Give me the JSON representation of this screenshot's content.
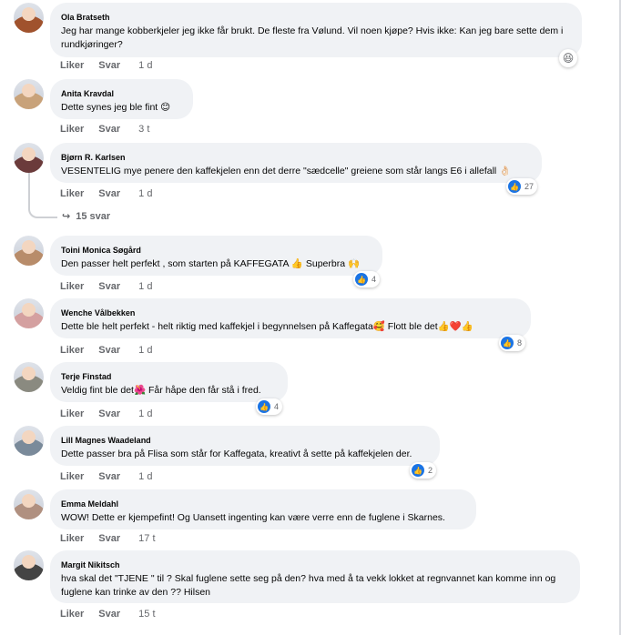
{
  "comments": [
    {
      "author": "Ola Bratseth",
      "text": "Jeg har mange kobberkjeler jeg ikke får brukt. De fleste fra Vølund. Vil noen kjøpe? Hvis ikke: Kan jeg bare sette dem i rundkjøringer?",
      "like": "Liker",
      "reply": "Svar",
      "time": "1 d",
      "reaction_emoji": "😆",
      "reaction_count": "",
      "avatar_color": "#a0522d"
    },
    {
      "author": "Anita Kravdal",
      "text": "Dette synes jeg ble fint 😊",
      "like": "Liker",
      "reply": "Svar",
      "time": "3 t",
      "reaction_emoji": "",
      "reaction_count": "",
      "avatar_color": "#c8a27a"
    },
    {
      "author": "Bjørn R. Karlsen",
      "text": "VESENTELIG mye penere den kaffekjelen enn det derre \"sædcelle\" greiene som står langs E6 i allefall 👌🏻",
      "like": "Liker",
      "reply": "Svar",
      "time": "1 d",
      "reaction_emoji": "👍",
      "reaction_count": "27",
      "avatar_color": "#6b3b3b"
    },
    {
      "author": "Toini Monica Søgård",
      "text": "Den passer helt perfekt , som starten på KAFFEGATA 👍 Superbra 🙌",
      "like": "Liker",
      "reply": "Svar",
      "time": "1 d",
      "reaction_emoji": "👍",
      "reaction_count": "4",
      "avatar_color": "#b88c6a"
    },
    {
      "author": "Wenche Vålbekken",
      "text": "Dette ble helt perfekt - helt riktig med kaffekjel i begynnelsen på Kaffegata🥰 Flott ble det👍❤️👍",
      "like": "Liker",
      "reply": "Svar",
      "time": "1 d",
      "reaction_emoji": "👍",
      "reaction_count": "8",
      "avatar_color": "#d4a0a0"
    },
    {
      "author": "Terje Finstad",
      "text": "Veldig fint ble det🌺 Får håpe den får stå i fred.",
      "like": "Liker",
      "reply": "Svar",
      "time": "1 d",
      "reaction_emoji": "👍",
      "reaction_count": "4",
      "avatar_color": "#8a8a80"
    },
    {
      "author": "Lill Magnes Waadeland",
      "text": "Dette passer bra på Flisa som står for Kaffegata, kreativt å sette på kaffekjelen der.",
      "like": "Liker",
      "reply": "Svar",
      "time": "1 d",
      "reaction_emoji": "👍",
      "reaction_count": "2",
      "avatar_color": "#7a8a9a"
    },
    {
      "author": "Emma Meldahl",
      "text": "WOW! Dette er kjempefint! Og Uansett ingenting kan være verre enn de fuglene i Skarnes.",
      "like": "Liker",
      "reply": "Svar",
      "time": "17 t",
      "reaction_emoji": "",
      "reaction_count": "",
      "avatar_color": "#b09080"
    },
    {
      "author": "Margit Nikitsch",
      "text": "hva skal det \"TJENE \" til ? Skal fuglene sette seg på den? hva med å ta vekk lokket at regnvannet kan komme inn og fuglene kan trinke av den ?? Hilsen",
      "like": "Liker",
      "reply": "Svar",
      "time": "15 t",
      "reaction_emoji": "",
      "reaction_count": "",
      "avatar_color": "#444444"
    }
  ],
  "thread": {
    "replies_label": "15 svar",
    "reply_arrow": "↪"
  },
  "colors": {
    "bubble": "#f0f2f5",
    "meta": "#65676b",
    "like_blue": "#1b74e4"
  }
}
